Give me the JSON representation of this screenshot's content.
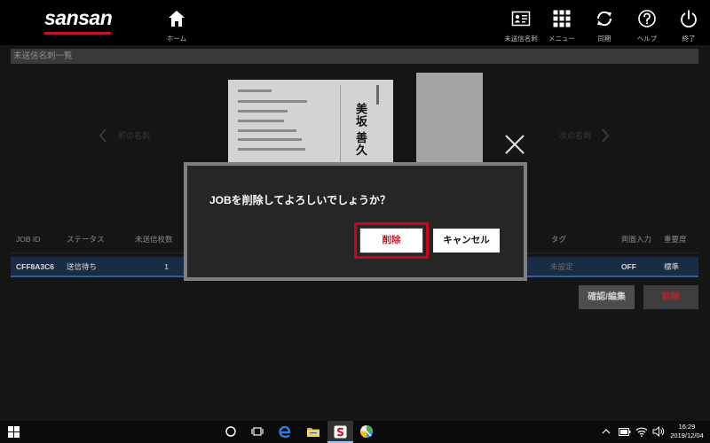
{
  "header": {
    "logo": "sansan",
    "nav": {
      "home": "ホーム",
      "unsent_cards": "未送信名刺",
      "menu": "メニュー",
      "sync": "同期",
      "help": "ヘルプ",
      "exit": "終了"
    }
  },
  "page": {
    "title": "未送信名刺一覧",
    "prev_card": "前の名刺",
    "next_card": "次の名刺"
  },
  "card": {
    "name": "美坂 善久"
  },
  "table": {
    "columns": {
      "job_id": "JOB ID",
      "status": "ステータス",
      "unsent_count": "未送信枚数",
      "tag": "タグ",
      "duplex": "両面入力",
      "priority": "重要度"
    },
    "rows": [
      {
        "job_id": "CFF8A3C6",
        "status": "送信待ち",
        "unsent_count": "1",
        "tag": "未設定",
        "duplex": "OFF",
        "priority": "標準"
      }
    ]
  },
  "actions": {
    "confirm_edit": "確認/編集",
    "delete": "削除"
  },
  "dialog": {
    "message": "JOBを削除してよろしいでしょうか？",
    "delete": "削除",
    "cancel": "キャンセル"
  },
  "taskbar": {
    "time": "16:29",
    "date": "2019/12/04"
  },
  "theme": {
    "brand_red": "#c8102e",
    "highlight_red": "#d0021b",
    "selected_row": "#1a2c44",
    "selected_row_line": "#2f5f9e",
    "dialog_bg": "#262626"
  },
  "icons": {
    "home": "home-icon",
    "unsent_cards": "id-card-icon",
    "menu": "grid-icon",
    "sync": "sync-icon",
    "help": "help-icon",
    "exit": "power-icon",
    "close": "close-icon"
  }
}
